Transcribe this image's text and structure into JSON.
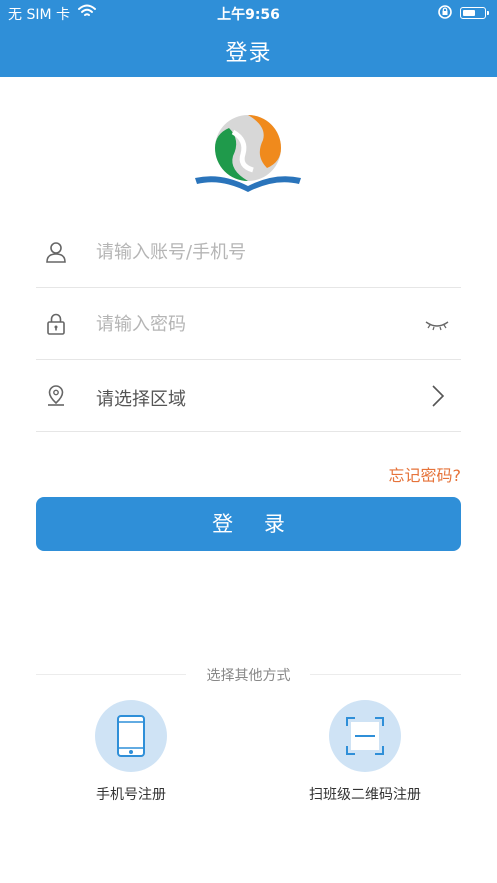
{
  "status_bar": {
    "carrier": "无 SIM 卡",
    "time": "上午9:56"
  },
  "header": {
    "title": "登录"
  },
  "form": {
    "account_placeholder": "请输入账号/手机号",
    "password_placeholder": "请输入密码",
    "region_label": "请选择区域"
  },
  "forgot_password": "忘记密码?",
  "login_button": "登 录",
  "other_methods": {
    "label": "选择其他方式",
    "options": [
      {
        "label": "手机号注册",
        "icon": "phone-icon"
      },
      {
        "label": "扫班级二维码注册",
        "icon": "scan-icon"
      }
    ]
  },
  "colors": {
    "primary": "#2f8fd8",
    "accent": "#e6733a",
    "option_circle": "#cfe3f5"
  }
}
